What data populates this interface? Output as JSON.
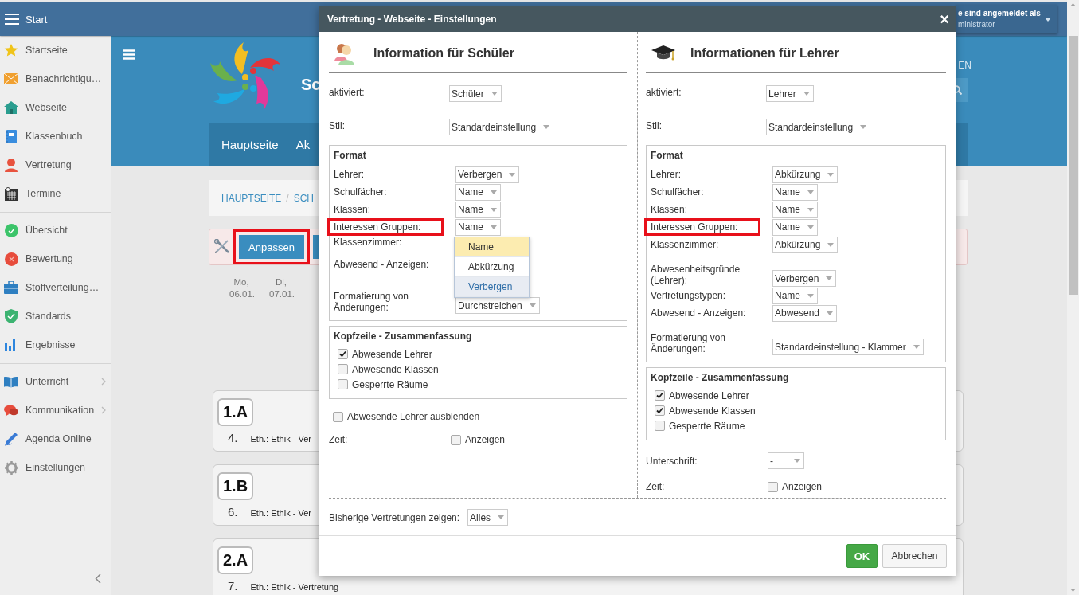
{
  "topbar": {
    "title": "Start",
    "user_line": "e sind angemeldet als",
    "user_name": "ministrator"
  },
  "sidebar": {
    "groups": [
      [
        {
          "label": "Startseite",
          "expandable": false
        },
        {
          "label": "Benachrichtigu…",
          "expandable": false
        },
        {
          "label": "Webseite",
          "expandable": false
        },
        {
          "label": "Klassenbuch",
          "expandable": false
        },
        {
          "label": "Vertretung",
          "expandable": false
        },
        {
          "label": "Termine",
          "expandable": false
        }
      ],
      [
        {
          "label": "Übersicht",
          "expandable": false
        },
        {
          "label": "Bewertung",
          "expandable": false
        },
        {
          "label": "Stoffverteilung…",
          "expandable": false
        },
        {
          "label": "Standards",
          "expandable": false
        },
        {
          "label": "Ergebnisse",
          "expandable": false
        }
      ],
      [
        {
          "label": "Unterricht",
          "expandable": true
        },
        {
          "label": "Kommunikation",
          "expandable": true
        },
        {
          "label": "Agenda Online",
          "expandable": false
        },
        {
          "label": "Einstellungen",
          "expandable": false
        }
      ]
    ]
  },
  "header": {
    "site_name": "Sc",
    "language": "EN",
    "nav": [
      "Hauptseite",
      "Ak"
    ]
  },
  "breadcrumb": {
    "items": [
      "HAUPTSEITE",
      "SCH"
    ],
    "separator": "/"
  },
  "toolbar": {
    "buttons": [
      {
        "label": "Anpassen",
        "highlighted": true
      }
    ]
  },
  "days": [
    {
      "day": "Mo,",
      "date": "06.01."
    },
    {
      "day": "Di,",
      "date": "07.01."
    }
  ],
  "cards": [
    {
      "class": "1.A",
      "lesson": "4.",
      "text": "Eth.: Ethik - Ver"
    },
    {
      "class": "1.B",
      "lesson": "6.",
      "text": "Eth.: Ethik - Ver"
    },
    {
      "class": "2.A",
      "lesson": "7.",
      "text": "Eth.: Ethik - Vertretung"
    }
  ],
  "dialog": {
    "title": "Vertretung - Webseite - Einstellungen",
    "close": "×",
    "columns": [
      {
        "heading": "Information für Schüler",
        "fields": [
          {
            "label": "aktiviert:",
            "value": "Schüler"
          },
          {
            "label": "Stil:",
            "value": "Standardeinstellung"
          }
        ],
        "format": {
          "title": "Format",
          "rows": [
            {
              "label": "Lehrer:",
              "value": "Verbergen",
              "highlighted": false
            },
            {
              "label": "Schulfächer:",
              "value": "Name",
              "highlighted": false
            },
            {
              "label": "Klassen:",
              "value": "Name",
              "highlighted": false
            },
            {
              "label": "Interessen Gruppen:",
              "value": "Name",
              "highlighted": true,
              "open": true,
              "options": [
                {
                  "label": "Name",
                  "selected": true,
                  "hovered": false
                },
                {
                  "label": "Abkürzung",
                  "selected": false,
                  "hovered": false
                },
                {
                  "label": "Verbergen",
                  "selected": false,
                  "hovered": true
                }
              ]
            },
            {
              "label": "Klassenzimmer:",
              "highlighted": false
            },
            {
              "label": "Abwesend - Anzeigen:",
              "highlighted": false
            },
            {
              "label": "Formatierung von\nÄnderungen:",
              "value": "Durchstreichen",
              "highlighted": false
            }
          ]
        },
        "summary": {
          "title": "Kopfzeile - Zusammenfassung",
          "items": [
            {
              "label": "Abwesende Lehrer",
              "checked": true
            },
            {
              "label": "Abwesende Klassen",
              "checked": false
            },
            {
              "label": "Gesperrte Räume",
              "checked": false
            }
          ]
        },
        "extras": [
          {
            "kind": "checkbox",
            "label": "Abwesende Lehrer ausblenden",
            "checked": false
          },
          {
            "kind": "checkbox_field",
            "label": "Zeit:",
            "option": "Anzeigen",
            "checked": false
          }
        ]
      },
      {
        "heading": "Informationen für Lehrer",
        "fields": [
          {
            "label": "aktiviert:",
            "value": "Lehrer"
          },
          {
            "label": "Stil:",
            "value": "Standardeinstellung"
          }
        ],
        "format": {
          "title": "Format",
          "rows": [
            {
              "label": "Lehrer:",
              "value": "Abkürzung",
              "highlighted": false
            },
            {
              "label": "Schulfächer:",
              "value": "Name",
              "highlighted": false
            },
            {
              "label": "Klassen:",
              "value": "Name",
              "highlighted": false
            },
            {
              "label": "Interessen Gruppen:",
              "value": "Name",
              "highlighted": true
            },
            {
              "label": "Klassenzimmer:",
              "value": "Abkürzung",
              "highlighted": false
            },
            {
              "label": "Abwesenheitsgründe\n(Lehrer):",
              "value": "Verbergen",
              "highlighted": false
            },
            {
              "label": "Vertretungstypen:",
              "value": "Name",
              "highlighted": false
            },
            {
              "label": "Abwesend - Anzeigen:",
              "value": "Abwesend",
              "highlighted": false
            },
            {
              "label": "Formatierung von\nÄnderungen:",
              "value": "Standardeinstellung - Klammer",
              "highlighted": false
            }
          ]
        },
        "summary": {
          "title": "Kopfzeile - Zusammenfassung",
          "items": [
            {
              "label": "Abwesende Lehrer",
              "checked": true
            },
            {
              "label": "Abwesende Klassen",
              "checked": true
            },
            {
              "label": "Gesperrte Räume",
              "checked": false
            }
          ]
        },
        "extras": [
          {
            "kind": "select",
            "label": "Unterschrift:",
            "value": "-"
          },
          {
            "kind": "checkbox_field",
            "label": "Zeit:",
            "option": "Anzeigen",
            "checked": false
          }
        ]
      }
    ],
    "history": {
      "label": "Bisherige Vertretungen zeigen:",
      "value": "Alles"
    },
    "buttons": [
      {
        "label": "OK",
        "kind": "primary"
      },
      {
        "label": "Abbrechen",
        "kind": "secondary"
      }
    ]
  }
}
